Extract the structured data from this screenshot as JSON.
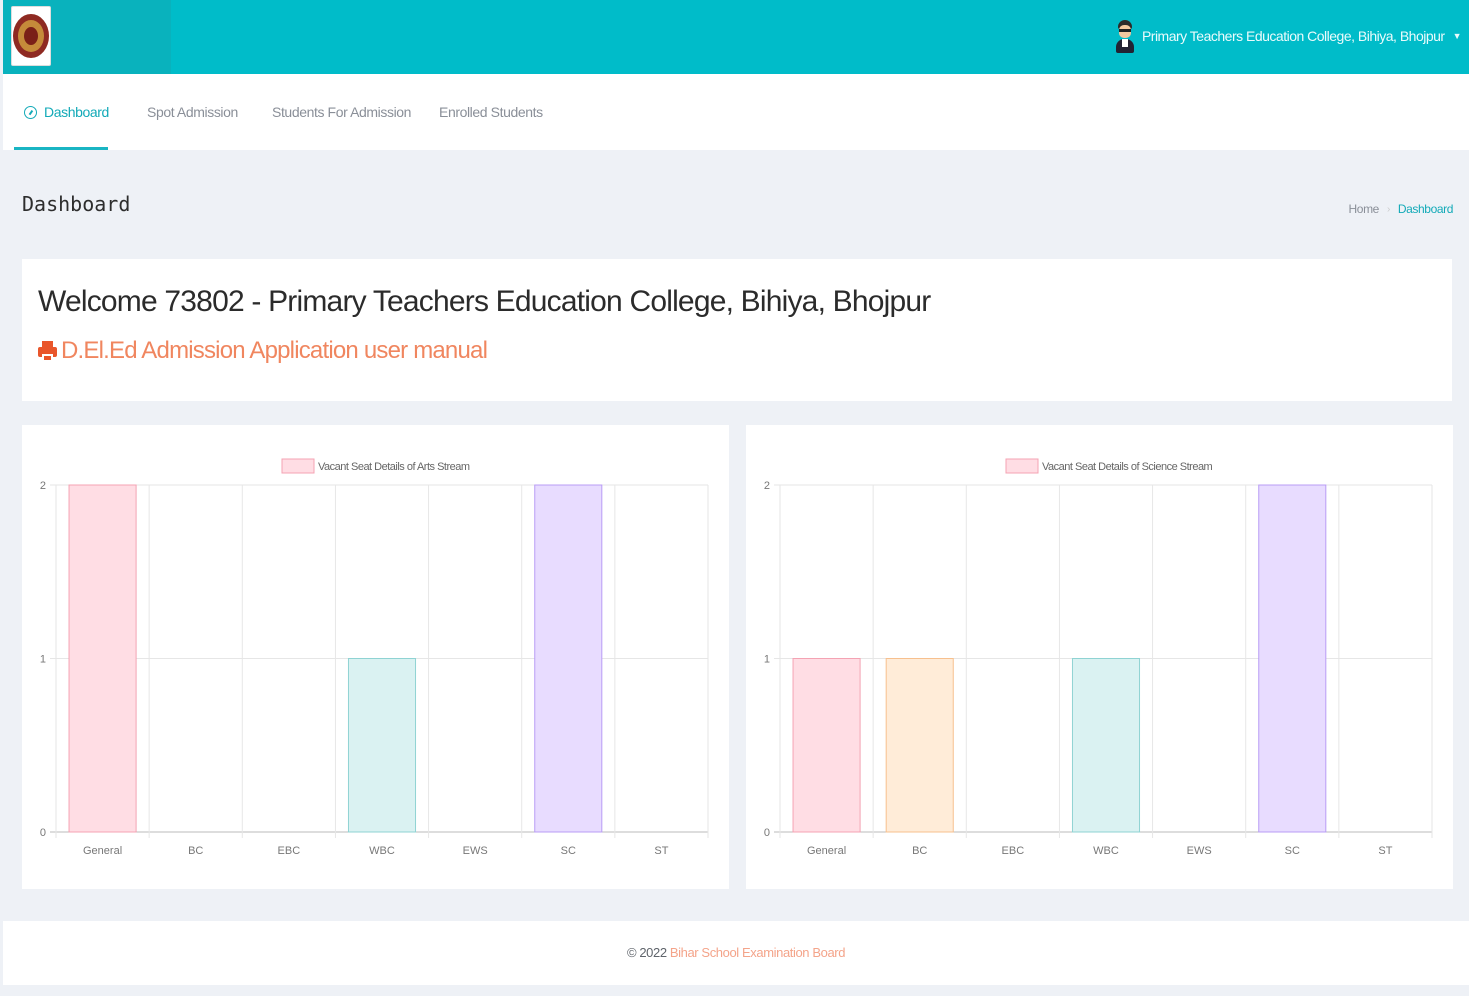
{
  "header": {
    "user_name": "Primary Teachers Education College, Bihiya, Bhojpur"
  },
  "nav": {
    "tabs": [
      {
        "label": "Dashboard",
        "active": true
      },
      {
        "label": "Spot Admission",
        "active": false
      },
      {
        "label": "Students For Admission",
        "active": false
      },
      {
        "label": "Enrolled Students",
        "active": false
      }
    ]
  },
  "page": {
    "title": "Dashboard",
    "breadcrumb": {
      "home": "Home",
      "current": "Dashboard"
    }
  },
  "welcome": {
    "title": "Welcome 73802 - Primary Teachers Education College, Bihiya, Bhojpur",
    "manual_link": "D.El.Ed Admission Application user manual"
  },
  "chart_data": [
    {
      "type": "bar",
      "legend": "Vacant Seat Details of Arts Stream",
      "categories": [
        "General",
        "BC",
        "EBC",
        "WBC",
        "EWS",
        "SC",
        "ST"
      ],
      "values": [
        2,
        0,
        0,
        1,
        0,
        2,
        0
      ],
      "ylim": [
        0,
        2
      ],
      "yticks": [
        "0",
        "1",
        "2"
      ],
      "grid": true,
      "legend_position": "top",
      "colors": [
        "#ffdde4",
        "#ffecd8",
        "#fff6da",
        "#daf2f2",
        "#d7ebfd",
        "#e8dcff",
        "#eeeef0"
      ],
      "borders": [
        "#f4a3b3",
        "#f7c08e",
        "#f5d88a",
        "#8fd3d3",
        "#8ec3f0",
        "#b99cf5",
        "#c8c9cc"
      ]
    },
    {
      "type": "bar",
      "legend": "Vacant Seat Details of Science Stream",
      "categories": [
        "General",
        "BC",
        "EBC",
        "WBC",
        "EWS",
        "SC",
        "ST"
      ],
      "values": [
        1,
        1,
        0,
        1,
        0,
        2,
        0
      ],
      "ylim": [
        0,
        2
      ],
      "yticks": [
        "0",
        "1",
        "2"
      ],
      "grid": true,
      "legend_position": "top",
      "colors": [
        "#ffdde4",
        "#ffecd8",
        "#fff6da",
        "#daf2f2",
        "#d7ebfd",
        "#e8dcff",
        "#eeeef0"
      ],
      "borders": [
        "#f4a3b3",
        "#f7c08e",
        "#f5d88a",
        "#8fd3d3",
        "#8ec3f0",
        "#b99cf5",
        "#c8c9cc"
      ]
    }
  ],
  "footer": {
    "copyright": "© 2022",
    "org": "Bihar School Examination Board"
  },
  "theme": {
    "primary": "#00bcc9",
    "accent": "#f0865f"
  }
}
